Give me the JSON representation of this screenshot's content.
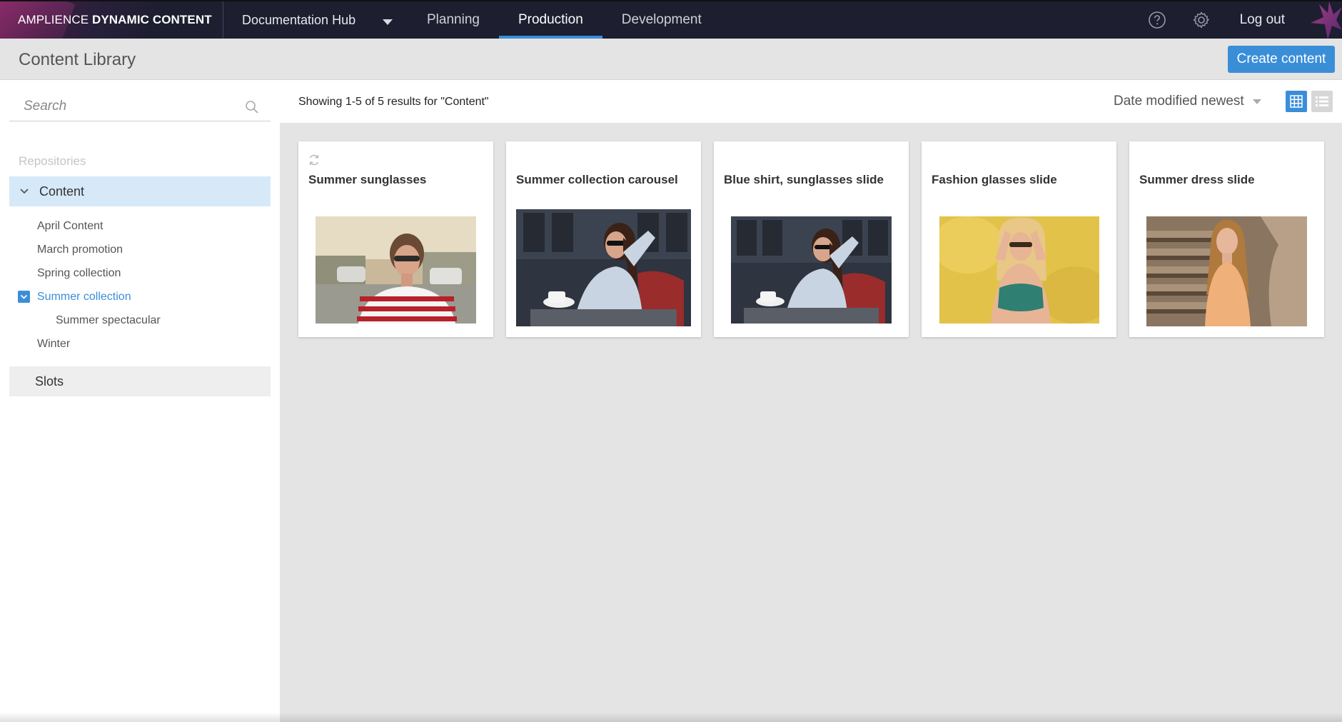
{
  "nav": {
    "brand_light": "AMPLIENCE",
    "brand_bold": "DYNAMIC CONTENT",
    "hub": "Documentation Hub",
    "tabs": [
      {
        "label": "Planning"
      },
      {
        "label": "Production"
      },
      {
        "label": "Development"
      }
    ],
    "active_tab": "Production",
    "logout": "Log out"
  },
  "header": {
    "title": "Content Library",
    "create_label": "Create content"
  },
  "sidebar": {
    "search_placeholder": "Search",
    "repositories_label": "Repositories",
    "repository": "Content",
    "folders": [
      {
        "label": "April Content"
      },
      {
        "label": "March promotion"
      },
      {
        "label": "Spring collection"
      },
      {
        "label": "Summer collection"
      },
      {
        "label": "Summer spectacular"
      },
      {
        "label": "Winter"
      }
    ],
    "slots_label": "Slots"
  },
  "results": {
    "summary": "Showing 1-5 of 5 results for \"Content\"",
    "sort_label": "Date modified newest"
  },
  "cards": [
    {
      "title": "Summer sunglasses"
    },
    {
      "title": "Summer collection carousel"
    },
    {
      "title": "Blue shirt, sunglasses slide"
    },
    {
      "title": "Fashion glasses slide"
    },
    {
      "title": "Summer dress slide"
    }
  ],
  "colors": {
    "accent": "#3a8ed8",
    "nav_bg": "#1d1e30",
    "selected_repo_bg": "#d5e9f8"
  }
}
